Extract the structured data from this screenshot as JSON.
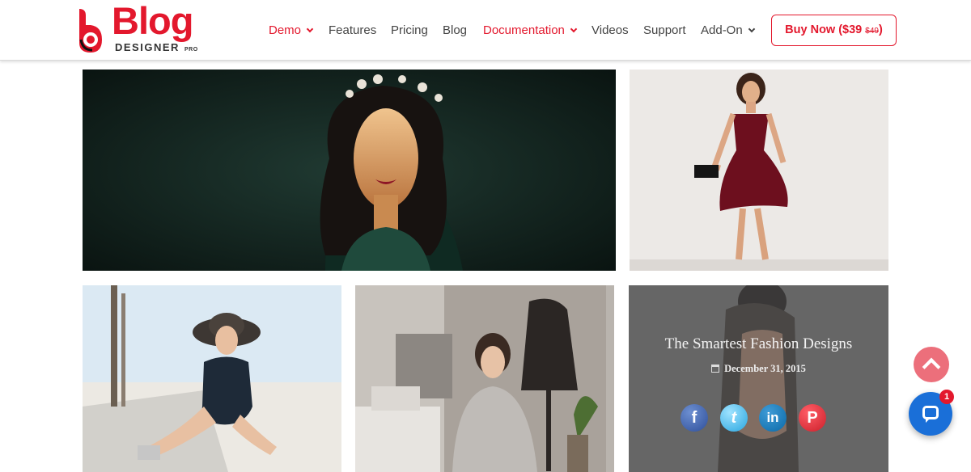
{
  "brand": {
    "name": "Blog",
    "sub": "DESIGNER",
    "tier": "PRO"
  },
  "nav": {
    "items": [
      {
        "label": "Demo",
        "dropdown": true,
        "active": true
      },
      {
        "label": "Features",
        "dropdown": false,
        "active": false
      },
      {
        "label": "Pricing",
        "dropdown": false,
        "active": false
      },
      {
        "label": "Blog",
        "dropdown": false,
        "active": false
      },
      {
        "label": "Documentation",
        "dropdown": true,
        "active": true
      },
      {
        "label": "Videos",
        "dropdown": false,
        "active": false
      },
      {
        "label": "Support",
        "dropdown": false,
        "active": false
      },
      {
        "label": "Add-On",
        "dropdown": true,
        "active": false
      }
    ],
    "buy": {
      "label": "Buy Now ($39",
      "old_price": "$49",
      "close": ")"
    }
  },
  "featured_post": {
    "title": "The Smartest Fashion Designs",
    "date": "December 31, 2015",
    "share": [
      {
        "icon": "facebook-icon",
        "glyph": "f"
      },
      {
        "icon": "twitter-icon",
        "glyph": "t"
      },
      {
        "icon": "linkedin-icon",
        "glyph": "in"
      },
      {
        "icon": "pinterest-icon",
        "glyph": "P"
      }
    ]
  },
  "chat": {
    "unread": "1"
  },
  "colors": {
    "accent": "#e3182d",
    "chat": "#1a6fd8",
    "scroll_top": "#ec6f7b"
  }
}
